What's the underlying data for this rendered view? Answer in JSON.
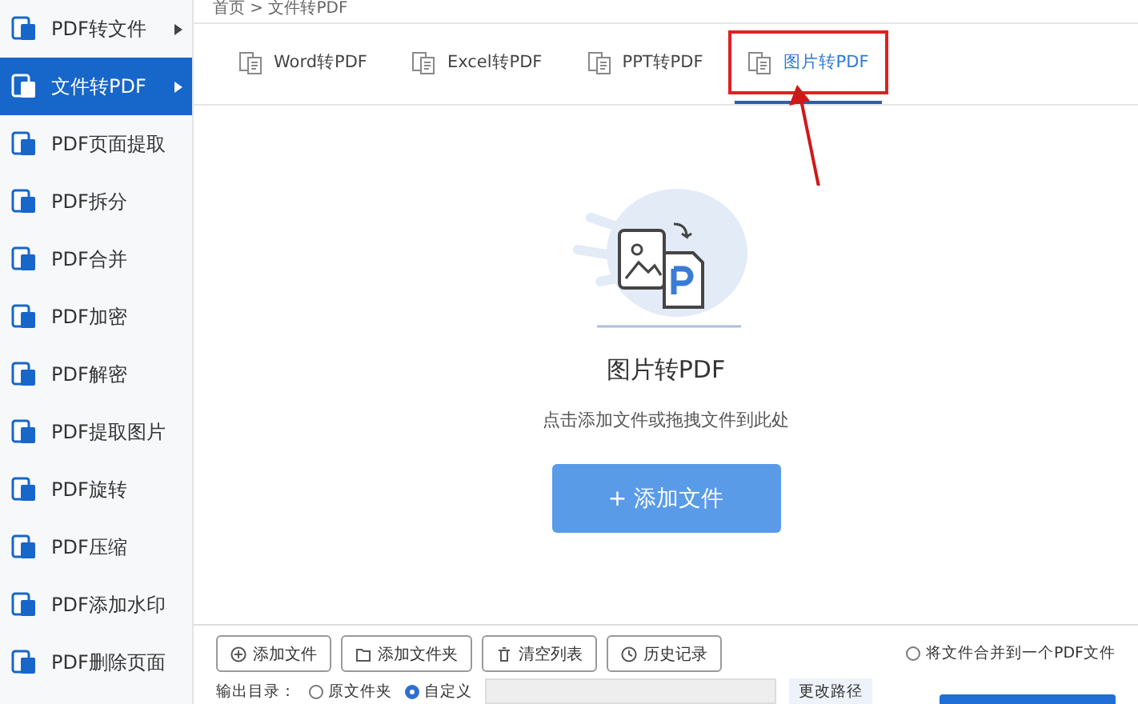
{
  "sidebar": {
    "items": [
      {
        "label": "PDF转文件",
        "selected": false,
        "submenu": true
      },
      {
        "label": "文件转PDF",
        "selected": true,
        "submenu": true
      },
      {
        "label": "PDF页面提取",
        "selected": false,
        "submenu": false
      },
      {
        "label": "PDF拆分",
        "selected": false,
        "submenu": false
      },
      {
        "label": "PDF合并",
        "selected": false,
        "submenu": false
      },
      {
        "label": "PDF加密",
        "selected": false,
        "submenu": false
      },
      {
        "label": "PDF解密",
        "selected": false,
        "submenu": false
      },
      {
        "label": "PDF提取图片",
        "selected": false,
        "submenu": false
      },
      {
        "label": "PDF旋转",
        "selected": false,
        "submenu": false
      },
      {
        "label": "PDF压缩",
        "selected": false,
        "submenu": false
      },
      {
        "label": "PDF添加水印",
        "selected": false,
        "submenu": false
      },
      {
        "label": "PDF删除页面",
        "selected": false,
        "submenu": false
      }
    ]
  },
  "breadcrumb": "首页 > 文件转PDF",
  "tabs": [
    {
      "label": "Word转PDF",
      "selected": false
    },
    {
      "label": "Excel转PDF",
      "selected": false
    },
    {
      "label": "PPT转PDF",
      "selected": false
    },
    {
      "label": "图片转PDF",
      "selected": true
    }
  ],
  "drop_zone": {
    "title": "图片转PDF",
    "hint": "点击添加文件或拖拽文件到此处",
    "button": "+ 添加文件"
  },
  "toolbar": [
    {
      "kind": "add",
      "label": "添加文件"
    },
    {
      "kind": "folder",
      "label": "添加文件夹"
    },
    {
      "kind": "clear",
      "label": "清空列表"
    },
    {
      "kind": "history",
      "label": "历史记录"
    }
  ],
  "merge_option": {
    "label": "将文件合并到一个PDF文件",
    "checked": false
  },
  "output": {
    "label": "输出目录：",
    "options": [
      {
        "label": "原文件夹",
        "selected": false
      },
      {
        "label": "自定义",
        "selected": true
      }
    ],
    "change_button": "更改路径"
  },
  "annotation": {
    "highlight": true
  }
}
